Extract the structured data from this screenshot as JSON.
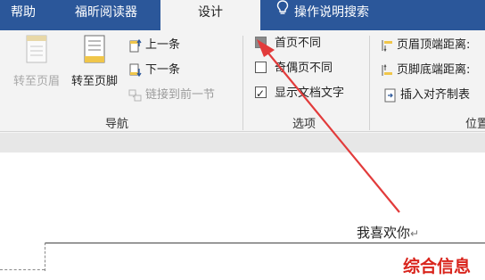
{
  "tabs": [
    {
      "label": "帮助",
      "active": false
    },
    {
      "label": "福昕阅读器",
      "active": false
    },
    {
      "label": "设计",
      "active": true
    },
    {
      "label": "操作说明搜索",
      "active": false,
      "icon": "lightbulb-icon"
    }
  ],
  "navigation": {
    "label": "导航",
    "goto_header": "转至页眉",
    "goto_footer": "转至页脚",
    "previous": "上一条",
    "next": "下一条",
    "link_previous": "链接到前一节"
  },
  "options": {
    "label": "选项",
    "different_first_page": "首页不同",
    "different_odd_even": "奇偶页不同",
    "show_document_text": "显示文档文字",
    "checked": {
      "different_first_page": true,
      "different_odd_even": false,
      "show_document_text": true
    }
  },
  "position": {
    "label": "位置",
    "header_from_top": "页眉顶端距离:",
    "footer_from_bottom": "页脚底端距离:",
    "insert_alignment_tab": "插入对齐制表"
  },
  "document": {
    "header_text": "我喜欢你"
  },
  "watermark": "综合信息",
  "colors": {
    "tab_bar": "#2b579a",
    "ribbon": "#f3f3f3",
    "annotation_arrow": "#e23b3b",
    "watermark": "#d9251d"
  }
}
